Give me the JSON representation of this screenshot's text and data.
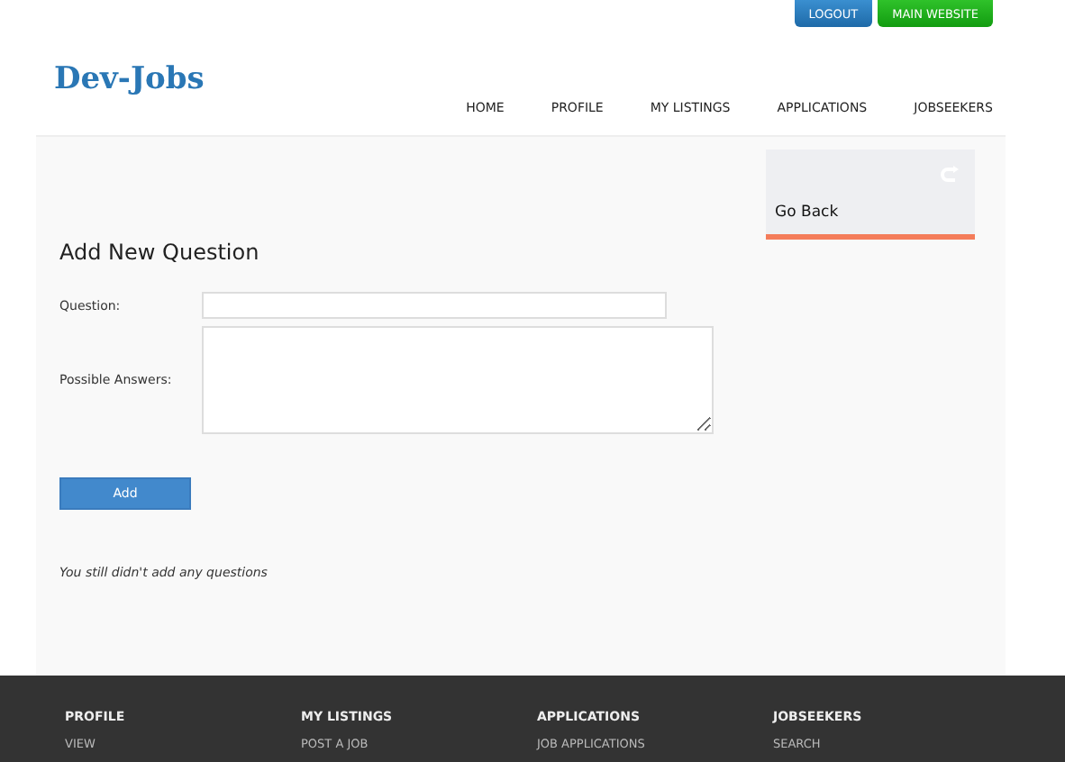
{
  "top_buttons": [
    {
      "label": "LOGOUT",
      "kind": "logout"
    },
    {
      "label": "MAIN WEBSITE",
      "kind": "website"
    }
  ],
  "logo": "Dev-Jobs",
  "nav": [
    "HOME",
    "PROFILE",
    "MY LISTINGS",
    "APPLICATIONS",
    "JOBSEEKERS"
  ],
  "go_back": {
    "label": "Go Back"
  },
  "heading": "Add New Question",
  "form": {
    "fields": [
      {
        "label": "Question:",
        "kind": "input"
      },
      {
        "label": "Possible Answers:",
        "kind": "textarea"
      }
    ],
    "submit": "Add"
  },
  "empty_message": "You still didn't add any questions",
  "footer": [
    {
      "title": "PROFILE",
      "links": [
        "VIEW"
      ]
    },
    {
      "title": "MY LISTINGS",
      "links": [
        "POST A JOB"
      ]
    },
    {
      "title": "APPLICATIONS",
      "links": [
        "JOB APPLICATIONS"
      ]
    },
    {
      "title": "JOBSEEKERS",
      "links": [
        "SEARCH"
      ]
    }
  ]
}
